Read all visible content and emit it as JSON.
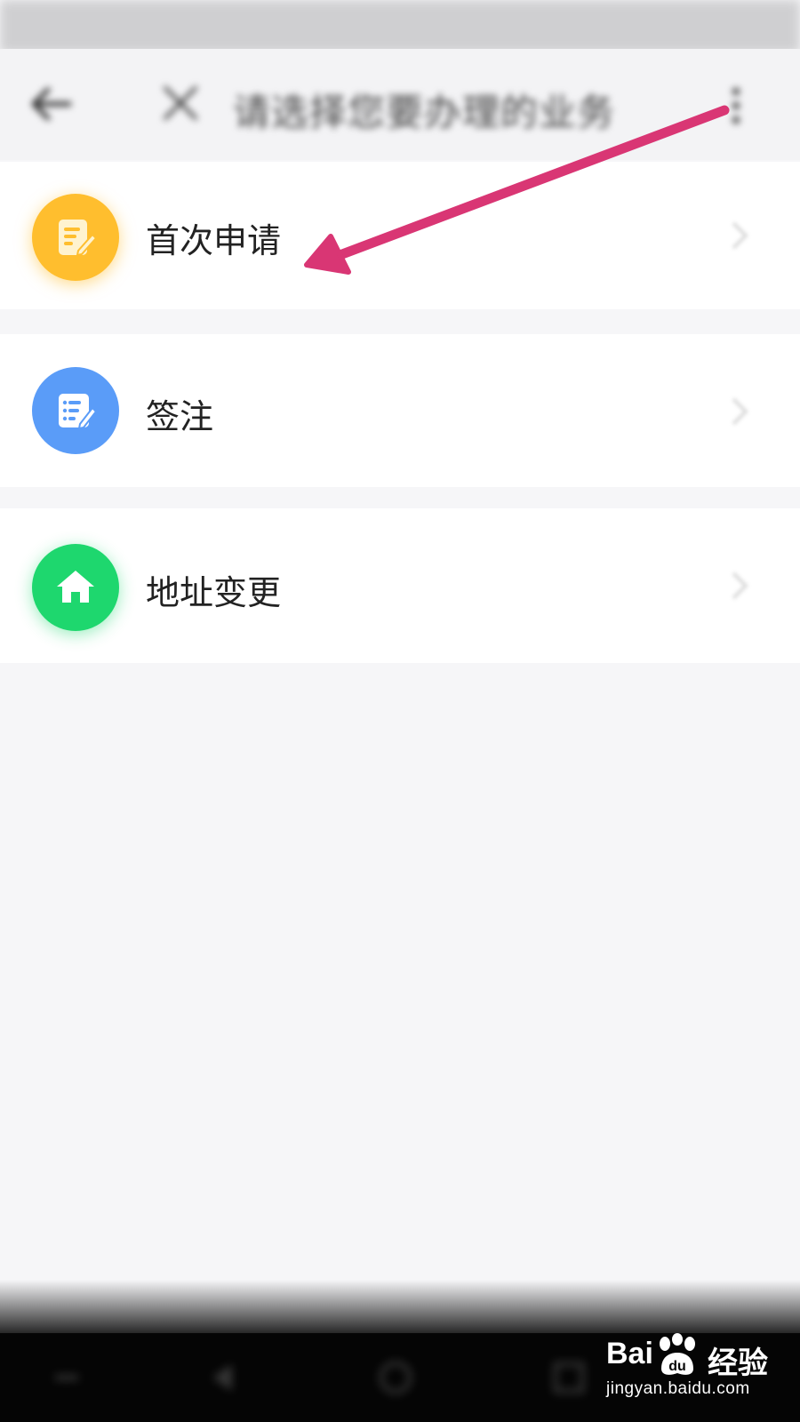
{
  "header": {
    "title": "请选择您要办理的业务"
  },
  "list": {
    "items": [
      {
        "label": "首次申请",
        "icon": "document-edit-icon",
        "color": "#ffbe2e"
      },
      {
        "label": "签注",
        "icon": "list-edit-icon",
        "color": "#5a9cf8"
      },
      {
        "label": "地址变更",
        "icon": "home-icon",
        "color": "#1ed76e"
      }
    ]
  },
  "annotation": {
    "arrow_color": "#d93674",
    "target": "首次申请"
  },
  "watermark": {
    "logo": "Bai",
    "logo_cn": "经验",
    "url": "jingyan.baidu.com"
  }
}
